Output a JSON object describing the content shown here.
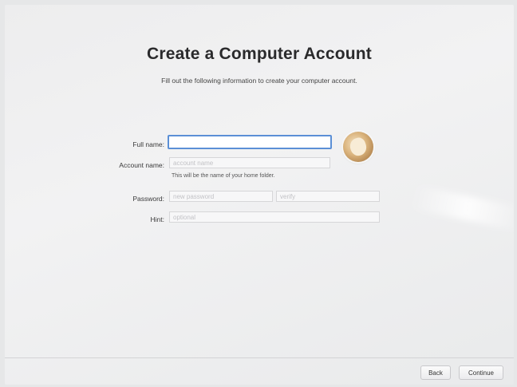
{
  "header": {
    "title": "Create a Computer Account",
    "subtitle": "Fill out the following information to create your computer account."
  },
  "form": {
    "full_name": {
      "label": "Full name:",
      "value": "",
      "placeholder": ""
    },
    "account_name": {
      "label": "Account name:",
      "value": "",
      "placeholder": "account name",
      "help": "This will be the name of your home folder."
    },
    "password": {
      "label": "Password:",
      "value": "",
      "placeholder": "new password"
    },
    "verify": {
      "value": "",
      "placeholder": "verify"
    },
    "hint": {
      "label": "Hint:",
      "value": "",
      "placeholder": "optional"
    }
  },
  "avatar": {
    "icon": "fortune-cookie-avatar"
  },
  "footer": {
    "back_label": "Back",
    "continue_label": "Continue"
  }
}
